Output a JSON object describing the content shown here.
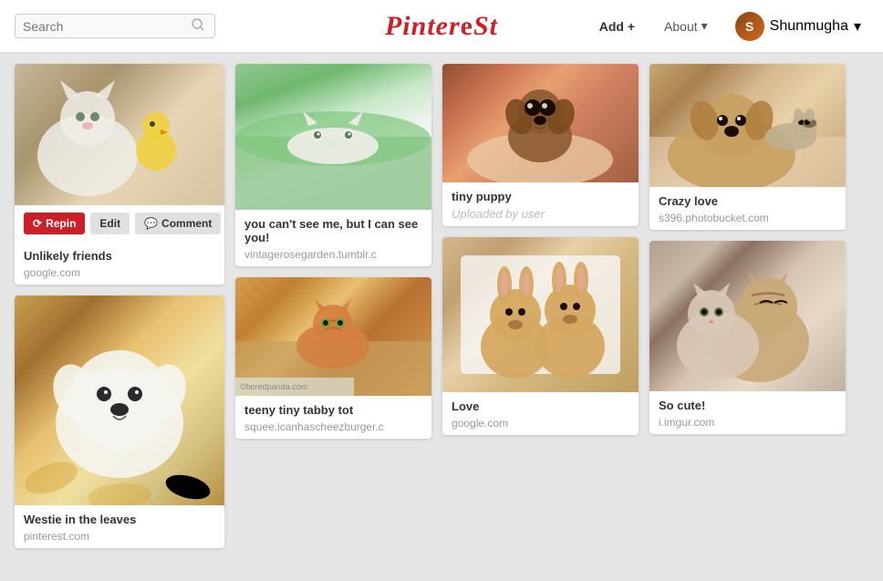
{
  "header": {
    "search_placeholder": "Search",
    "logo": "Pinterest",
    "add_label": "Add +",
    "about_label": "About",
    "about_arrow": "▾",
    "user_name": "Shunmugha",
    "user_arrow": "▾"
  },
  "actions": {
    "repin_label": "Repin",
    "edit_label": "Edit",
    "comment_label": "Comment"
  },
  "columns": [
    {
      "id": "col1",
      "cards": [
        {
          "id": "card-unlikely",
          "image_class": "img-cat-chick",
          "title": "Unlikely friends",
          "source": "google.com",
          "hovered": true
        },
        {
          "id": "card-westie",
          "image_class": "img-white-dog",
          "title": "Westie in the leaves",
          "source": "pinterest.com",
          "hovered": false
        }
      ]
    },
    {
      "id": "col2",
      "cards": [
        {
          "id": "card-cantseeme",
          "image_class": "img-cat-green",
          "title": "you can't see me, but I can see you!",
          "source": "vintagerosegarden.tumblr.c",
          "hovered": false
        },
        {
          "id": "card-tabby",
          "image_class": "img-orange-kitten",
          "title": "teeny tiny tabby tot",
          "source": "squee.icanhascheezburger.c",
          "hovered": false
        }
      ]
    },
    {
      "id": "col3",
      "cards": [
        {
          "id": "card-puppy",
          "image_class": "img-puppy",
          "title": "tiny puppy",
          "uploaded": "Uploaded by user",
          "source": null,
          "hovered": false
        },
        {
          "id": "card-love",
          "image_class": "img-bunnies",
          "title": "Love",
          "source": "google.com",
          "hovered": false
        }
      ]
    },
    {
      "id": "col4",
      "cards": [
        {
          "id": "card-crazylove",
          "image_class": "img-dog-ferret",
          "title": "Crazy love",
          "source": "s396.photobucket.com",
          "hovered": false
        },
        {
          "id": "card-socute",
          "image_class": "img-cats-cuddling",
          "title": "So cute!",
          "source": "i.imgur.com",
          "hovered": false
        }
      ]
    }
  ]
}
